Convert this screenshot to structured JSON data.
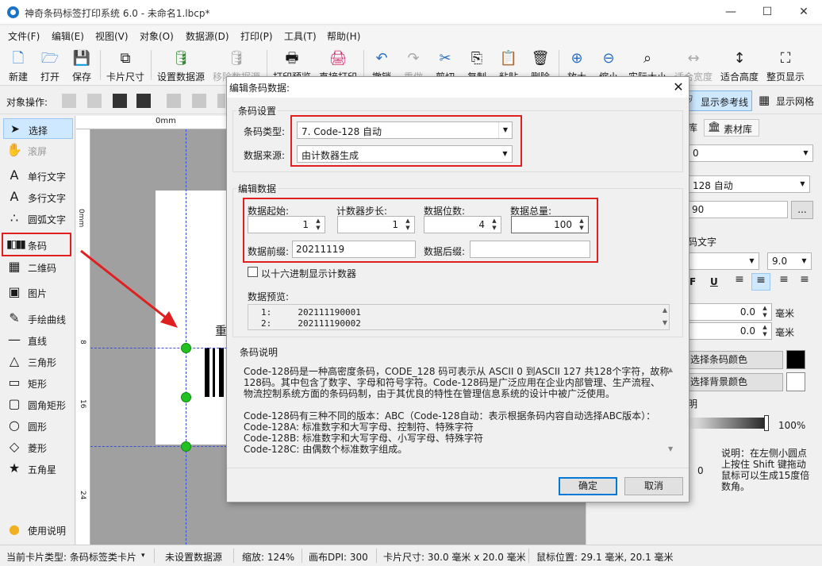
{
  "window": {
    "title": "神奇条码标签打印系统 6.0 - 未命名1.lbcp*",
    "minimize_glyph": "—",
    "maximize_glyph": "☐",
    "close_glyph": "✕"
  },
  "menu": [
    "文件(F)",
    "编辑(E)",
    "视图(V)",
    "对象(O)",
    "数据源(D)",
    "打印(P)",
    "工具(T)",
    "帮助(H)"
  ],
  "toolbar": [
    {
      "label": "新建",
      "icon": "new-file-icon",
      "glyph": "🗋"
    },
    {
      "label": "打开",
      "icon": "open-icon",
      "glyph": "🗁"
    },
    {
      "label": "保存",
      "icon": "save-icon",
      "glyph": "💾"
    },
    {
      "label": "卡片尺寸",
      "icon": "card-size-icon",
      "glyph": "⧉"
    },
    {
      "label": "设置数据源",
      "icon": "database-icon",
      "glyph": "🛢"
    },
    {
      "label": "移除数据源",
      "icon": "database-remove-icon",
      "glyph": "🛢"
    },
    {
      "label": "打印预览",
      "icon": "print-preview-icon",
      "glyph": "🖶"
    },
    {
      "label": "直接打印",
      "icon": "printer-icon",
      "glyph": "🖨"
    },
    {
      "label": "撤销",
      "icon": "undo-icon",
      "glyph": "↶"
    },
    {
      "label": "重做",
      "icon": "redo-icon",
      "glyph": "↷"
    },
    {
      "label": "剪切",
      "icon": "scissors-icon",
      "glyph": "✂"
    },
    {
      "label": "复制",
      "icon": "copy-icon",
      "glyph": "⎘"
    },
    {
      "label": "粘贴",
      "icon": "paste-icon",
      "glyph": "📋"
    },
    {
      "label": "删除",
      "icon": "trash-icon",
      "glyph": "🗑"
    },
    {
      "label": "放大",
      "icon": "zoom-in-icon",
      "glyph": "⊕"
    },
    {
      "label": "缩小",
      "icon": "zoom-out-icon",
      "glyph": "⊖"
    },
    {
      "label": "实际大小",
      "icon": "zoom-actual-icon",
      "glyph": "⌕"
    },
    {
      "label": "适合宽度",
      "icon": "fit-width-icon",
      "glyph": "↔"
    },
    {
      "label": "适合高度",
      "icon": "fit-height-icon",
      "glyph": "↕"
    },
    {
      "label": "整页显示",
      "icon": "fit-page-icon",
      "glyph": "⛶"
    }
  ],
  "ops": {
    "label": "对象操作:",
    "show_guides": "显示参考线",
    "show_grid": "显示网格"
  },
  "tools": [
    {
      "label": "选择",
      "icon": "cursor-arrow-icon",
      "glyph": "➤"
    },
    {
      "label": "滚屏",
      "icon": "hand-icon",
      "glyph": "✋"
    },
    {
      "label": "单行文字",
      "icon": "single-line-text-icon",
      "glyph": "A"
    },
    {
      "label": "多行文字",
      "icon": "multi-line-text-icon",
      "glyph": "A"
    },
    {
      "label": "圆弧文字",
      "icon": "arc-text-icon",
      "glyph": "∴"
    },
    {
      "label": "条码",
      "icon": "barcode-icon",
      "glyph": "▮"
    },
    {
      "label": "二维码",
      "icon": "qrcode-icon",
      "glyph": "▦"
    },
    {
      "label": "图片",
      "icon": "image-icon",
      "glyph": "▣"
    },
    {
      "label": "手绘曲线",
      "icon": "pen-icon",
      "glyph": "✎"
    },
    {
      "label": "直线",
      "icon": "line-icon",
      "glyph": "—"
    },
    {
      "label": "三角形",
      "icon": "triangle-icon",
      "glyph": "△"
    },
    {
      "label": "矩形",
      "icon": "rectangle-icon",
      "glyph": "▭"
    },
    {
      "label": "圆角矩形",
      "icon": "rounded-rectangle-icon",
      "glyph": "▢"
    },
    {
      "label": "圆形",
      "icon": "circle-icon",
      "glyph": "○"
    },
    {
      "label": "菱形",
      "icon": "diamond-icon",
      "glyph": "◇"
    },
    {
      "label": "五角星",
      "icon": "star-icon",
      "glyph": "★"
    },
    {
      "label": "使用说明",
      "icon": "lightbulb-icon",
      "glyph": "💡"
    }
  ],
  "canvas": {
    "ruler_top_zero": "0mm",
    "ruler_left": [
      "0mm",
      "8",
      "16",
      "24"
    ],
    "card_char": "重"
  },
  "right": {
    "tab_lib": "库",
    "tab_material": "素材库",
    "val_0": "0",
    "barcode_type": "128 自动",
    "data_val": "90",
    "more": "...",
    "text_label": "码文字",
    "font_size": "9.0",
    "offset1": "0.0",
    "offset2": "0.0",
    "unit": "毫米",
    "barcode_color": "选择条码颜色",
    "bg_color": "选择背景颜色",
    "alpha_label": "明",
    "alpha_value": "100%",
    "rotate_val": "0",
    "note": [
      "说明：在左侧小圆点",
      "上按住 Shift 键拖动",
      "鼠标可以生成15度倍",
      "数角。"
    ]
  },
  "status": {
    "card_type": "当前卡片类型: 条码标签类卡片",
    "datasource": "未设置数据源",
    "zoom": "缩放: 124%",
    "dpi": "画布DPI: 300",
    "card_size": "卡片尺寸: 30.0 毫米 x 20.0 毫米",
    "mouse_pos": "鼠标位置: 29.1 毫米, 20.1 毫米"
  },
  "dialog": {
    "title": "编辑条码数据:",
    "barcode_settings": "条码设置",
    "barcode_type_label": "条码类型:",
    "barcode_type_value": "7. Code-128 自动",
    "data_source_label": "数据来源:",
    "data_source_value": "由计数器生成",
    "edit_data": "编辑数据",
    "start_label": "数据起始:",
    "start_value": "1",
    "step_label": "计数器步长:",
    "step_value": "1",
    "digits_label": "数据位数:",
    "digits_value": "4",
    "total_label": "数据总量:",
    "total_value": "100",
    "prefix_label": "数据前缀:",
    "prefix_value": "20211119",
    "suffix_label": "数据后缀:",
    "suffix_value": "",
    "hex_label": "以十六进制显示计数器",
    "preview_label": "数据预览:",
    "preview_lines": [
      "1:     202111190001",
      "2:     202111190002"
    ],
    "desc_title": "条码说明",
    "desc_lines": [
      "Code-128码是一种高密度条码，CODE_128 码可表示从 ASCII 0 到ASCII 127 共128个字符，故称",
      "128码。其中包含了数字、字母和符号字符。Code-128码是广泛应用在企业内部管理、生产流程、",
      "物流控制系统方面的条码码制，由于其优良的特性在管理信息系统的设计中被广泛使用。",
      "",
      "Code-128码有三种不同的版本：ABC（Code-128自动：表示根据条码内容自动选择ABC版本）：",
      "Code-128A: 标准数字和大写字母、控制符、特殊字符",
      "Code-128B: 标准数字和大写字母、小写字母、特殊字符",
      "Code-128C: 由偶数个标准数字组成。"
    ],
    "ok": "确定",
    "cancel": "取消"
  },
  "colors": {
    "highlight_red": "#e02020",
    "guide_blue": "#3b4fd8",
    "handle_green": "#22c022"
  }
}
